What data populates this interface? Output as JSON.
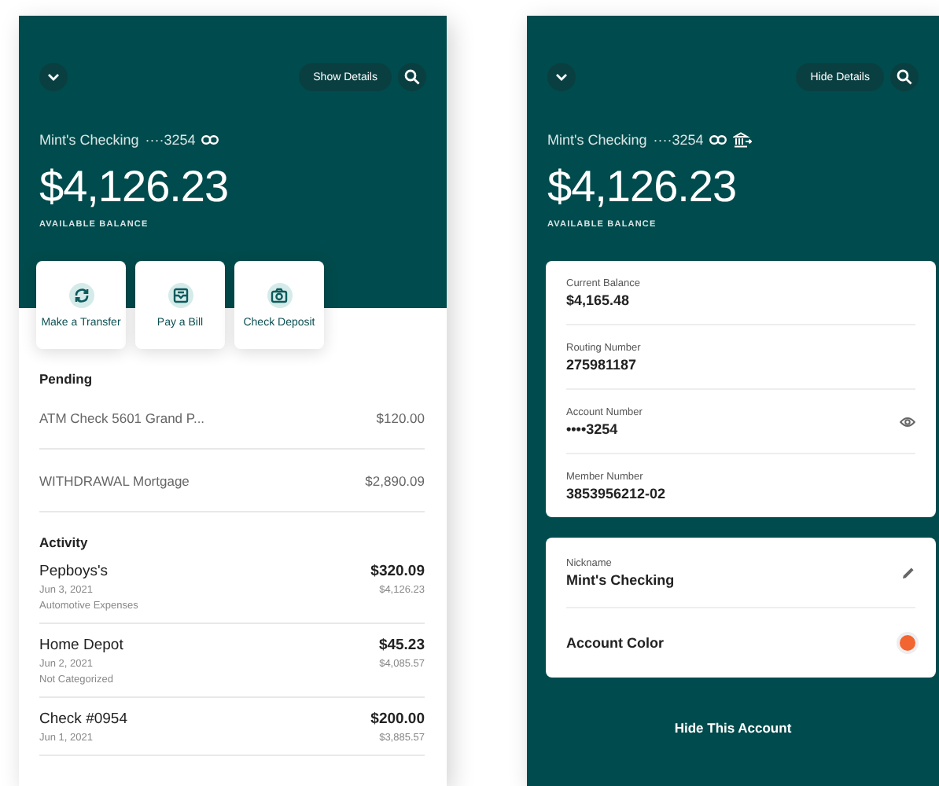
{
  "overview_screen": {
    "details_button": "Show Details",
    "account_name": "Mint's Checking",
    "masked_number": "····3254",
    "show_bank_icon": false,
    "balance": "$4,126.23",
    "balance_label": "AVAILABLE BALANCE",
    "actions": [
      {
        "kind": "transfer",
        "label": "Make a Transfer"
      },
      {
        "kind": "bill",
        "label": "Pay a Bill"
      },
      {
        "kind": "deposit",
        "label": "Check Deposit"
      }
    ],
    "pending_title": "Pending",
    "pending": [
      {
        "description": "ATM Check 5601 Grand P...",
        "amount": "$120.00"
      },
      {
        "description": "WITHDRAWAL Mortgage",
        "amount": "$2,890.09"
      }
    ],
    "activity_title": "Activity",
    "activity": [
      {
        "name": "Pepboys's",
        "date": "Jun 3, 2021",
        "category": "Automotive Expenses",
        "amount": "$320.09",
        "running_balance": "$4,126.23"
      },
      {
        "name": "Home Depot",
        "date": "Jun 2, 2021",
        "category": "Not Categorized",
        "amount": "$45.23",
        "running_balance": "$4,085.57"
      },
      {
        "name": "Check #0954",
        "date": "Jun 1, 2021",
        "amount": "$200.00",
        "running_balance": "$3,885.57"
      }
    ]
  },
  "details_screen": {
    "details_button": "Hide Details",
    "account_name": "Mint's Checking",
    "masked_number": "····3254",
    "show_bank_icon": true,
    "balance": "$4,126.23",
    "balance_label": "AVAILABLE BALANCE",
    "details": [
      {
        "label": "Current Balance",
        "value": "$4,165.48",
        "reveal": false
      },
      {
        "label": "Routing Number",
        "value": "275981187",
        "reveal": false
      },
      {
        "label": "Account Number",
        "value": "••••3254",
        "reveal": true
      },
      {
        "label": "Member Number",
        "value": "3853956212-02",
        "reveal": false
      }
    ],
    "settings": [
      {
        "kind": "nickname",
        "label": "Nickname",
        "value": "Mint's Checking"
      },
      {
        "kind": "color",
        "label": "Account Color",
        "color": "#f26430"
      }
    ],
    "hide_button": "Hide This Account"
  }
}
